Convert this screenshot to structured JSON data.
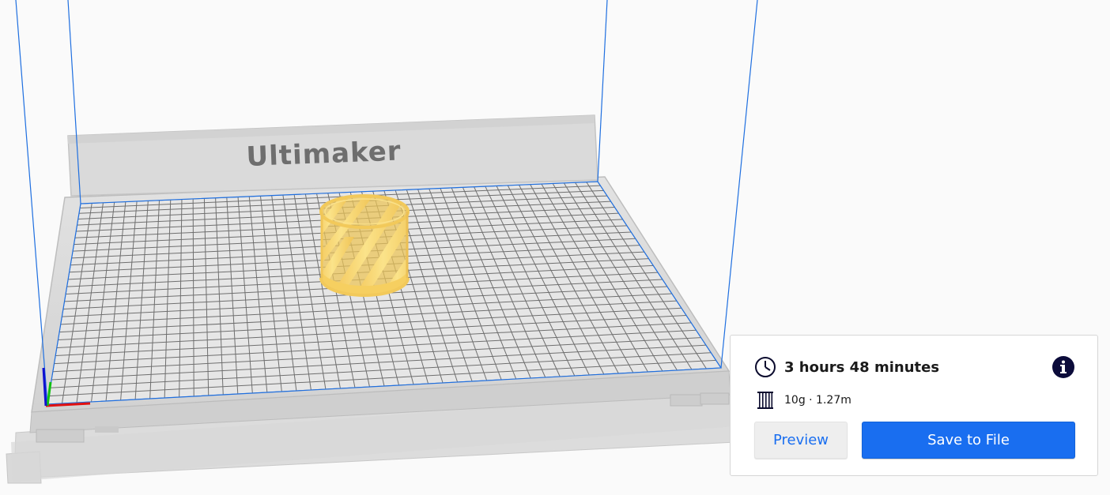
{
  "viewport": {
    "brand_label": "Ultimaker",
    "colors": {
      "background": "#fafafa",
      "build_volume_lines": "#1f6fe0",
      "plate": "#d6d6d6",
      "grid": "#5a5a5a",
      "model": "#f7d468",
      "axis_x": "#e01010",
      "axis_y": "#10c010",
      "axis_z": "#1010d0"
    }
  },
  "print_summary": {
    "time_icon": "clock-icon",
    "print_time": "3 hours 48 minutes",
    "info_icon": "info-icon",
    "material_icon": "spool-icon",
    "material": "10g · 1.27m",
    "preview_label": "Preview",
    "save_label": "Save to File",
    "colors": {
      "primary": "#196ef0",
      "secondary_bg": "#eeeeee"
    }
  }
}
